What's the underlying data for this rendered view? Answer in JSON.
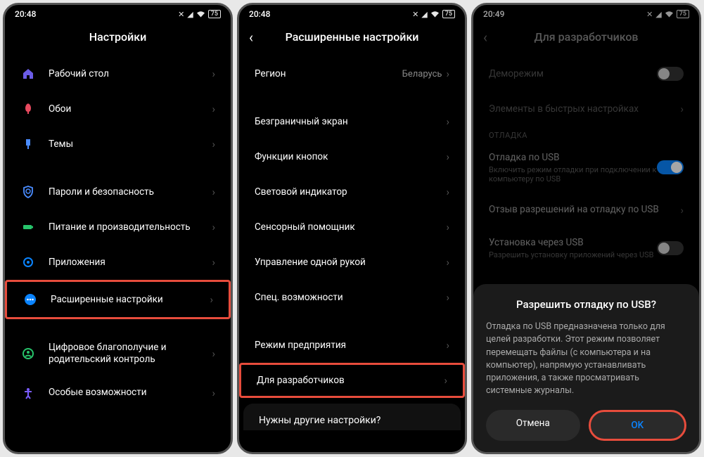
{
  "screen1": {
    "time": "20:48",
    "battery": "75",
    "title": "Настройки",
    "items": [
      {
        "label": "Рабочий стол",
        "icon": "home",
        "color": "#6b5ce7"
      },
      {
        "label": "Обои",
        "icon": "tulip",
        "color": "#e84a5f"
      },
      {
        "label": "Темы",
        "icon": "brush",
        "color": "#4a8cff"
      },
      {
        "label": "Пароли и безопасность",
        "icon": "shield",
        "color": "#4a8cff"
      },
      {
        "label": "Питание и производительность",
        "icon": "battery",
        "color": "#27c46b"
      },
      {
        "label": "Приложения",
        "icon": "gear",
        "color": "#0a84ff"
      },
      {
        "label": "Расширенные настройки",
        "icon": "dots",
        "color": "#0a84ff",
        "hl": true
      },
      {
        "label": "Цифровое благополучие и родительский контроль",
        "icon": "wellbeing",
        "color": "#27c46b"
      },
      {
        "label": "Особые возможности",
        "icon": "access",
        "color": "#7a5cff"
      }
    ]
  },
  "screen2": {
    "time": "20:48",
    "battery": "75",
    "title": "Расширенные настройки",
    "region_label": "Регион",
    "region_value": "Беларусь",
    "items": [
      {
        "label": "Безграничный экран"
      },
      {
        "label": "Функции кнопок"
      },
      {
        "label": "Световой индикатор"
      },
      {
        "label": "Сенсорный помощник"
      },
      {
        "label": "Управление одной рукой"
      },
      {
        "label": "Спец. возможности"
      }
    ],
    "items2": [
      {
        "label": "Режим предприятия"
      },
      {
        "label": "Для разработчиков",
        "hl": true
      }
    ],
    "footer": "Нужны другие настройки?"
  },
  "screen3": {
    "time": "20:49",
    "battery": "75",
    "title": "Для разработчиков",
    "top_items": [
      {
        "label": "Деморежим",
        "toggle": false
      },
      {
        "label": "Элементы в быстрых настройках",
        "chev": true
      }
    ],
    "section": "ОТЛАДКА",
    "debug_items": [
      {
        "label": "Отладка по USB",
        "sub": "Включить режим отладки при подключении к компьютеру по USB",
        "toggle": true,
        "on": true
      },
      {
        "label": "Отзыв разрешений на отладку по USB",
        "chev": true
      },
      {
        "label": "Установка через USB",
        "sub": "Разрешить установку приложений через USB",
        "toggle": true,
        "on": false
      }
    ],
    "dialog": {
      "title": "Разрешить отладку по USB?",
      "body": "Отладка по USB предназначена только для целей разработки. Этот режим позволяет перемещать файлы (с компьютера и на компьютер), напрямую устанавливать приложения, а также просматривать системные журналы.",
      "cancel": "Отмена",
      "ok": "OK"
    }
  }
}
